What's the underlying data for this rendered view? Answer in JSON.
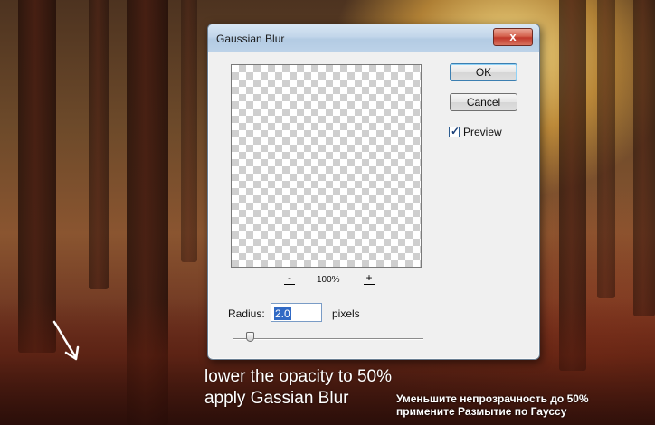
{
  "dialog": {
    "title": "Gaussian Blur",
    "close_glyph": "x",
    "ok_label": "OK",
    "cancel_label": "Cancel",
    "preview_checkbox": {
      "label": "Preview",
      "checked": true,
      "check_glyph": "✓"
    },
    "zoom": {
      "out_glyph": "-",
      "in_glyph": "+",
      "level": "100%"
    },
    "radius": {
      "label": "Radius:",
      "value": "2.0",
      "unit": "pixels"
    },
    "slider_level_fraction": 0.09
  },
  "overlay_text": {
    "en_line1": "lower the opacity to 50%",
    "en_line2": "apply Gassian Blur",
    "ru_line1": "Уменьшите непрозрачность до 50%",
    "ru_line2": "примените Размытие по Гауссу"
  },
  "icons": [
    "close-icon",
    "zoom-out-icon",
    "zoom-in-icon",
    "checkmark-icon",
    "arrow-icon"
  ],
  "colors": {
    "accent": "#316ac5",
    "close_button": "#c0392b",
    "caption_text": "#ffffff"
  }
}
